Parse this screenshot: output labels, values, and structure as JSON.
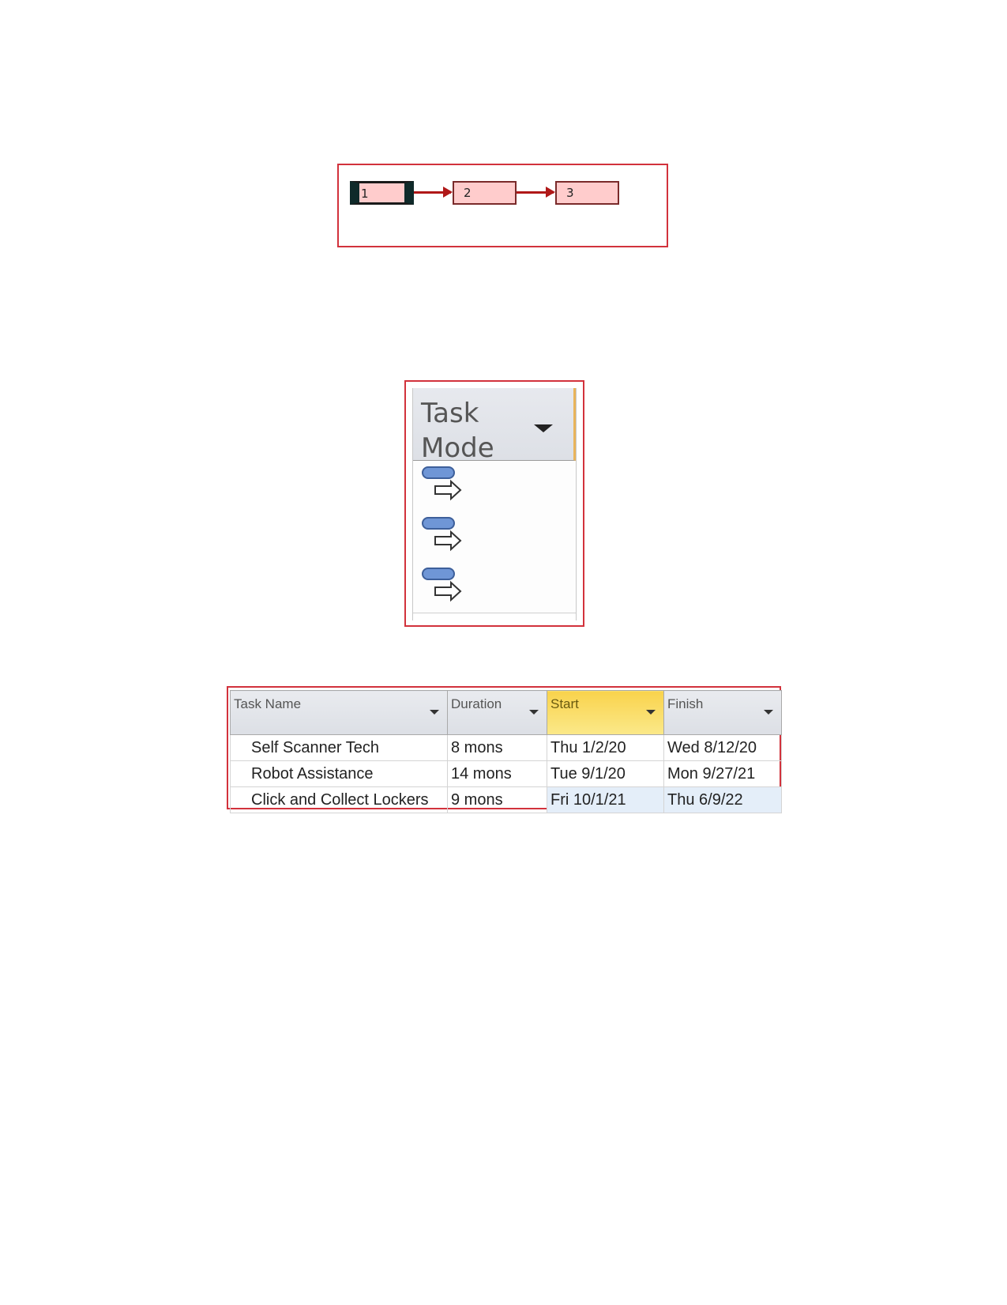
{
  "network_diagram": {
    "nodes": [
      {
        "label": "1",
        "selected": true
      },
      {
        "label": "2",
        "selected": false
      },
      {
        "label": "3",
        "selected": false
      }
    ],
    "links": [
      [
        "1",
        "2"
      ],
      [
        "2",
        "3"
      ]
    ],
    "colors": {
      "node_fill": "#ffcccc",
      "link": "#b01818",
      "frame": "#d2323c"
    }
  },
  "task_mode_column": {
    "header": "Task Mode",
    "rows": [
      {
        "icon": "auto-scheduled-task-icon"
      },
      {
        "icon": "auto-scheduled-task-icon"
      },
      {
        "icon": "auto-scheduled-task-icon"
      }
    ]
  },
  "task_table": {
    "columns": [
      "Task Name",
      "Duration",
      "Start",
      "Finish"
    ],
    "highlighted_column": "Start",
    "rows": [
      {
        "name": "Self Scanner Tech",
        "duration": "8 mons",
        "start": "Thu 1/2/20",
        "finish": "Wed 8/12/20"
      },
      {
        "name": "Robot Assistance",
        "duration": "14 mons",
        "start": "Tue 9/1/20",
        "finish": "Mon 9/27/21"
      },
      {
        "name": "Click and Collect Lockers",
        "duration": "9 mons",
        "start": "Fri 10/1/21",
        "finish": "Thu 6/9/22"
      }
    ],
    "colors": {
      "header_highlight": "#f9d34c",
      "selected_row_cells": "#e4eef9"
    }
  }
}
